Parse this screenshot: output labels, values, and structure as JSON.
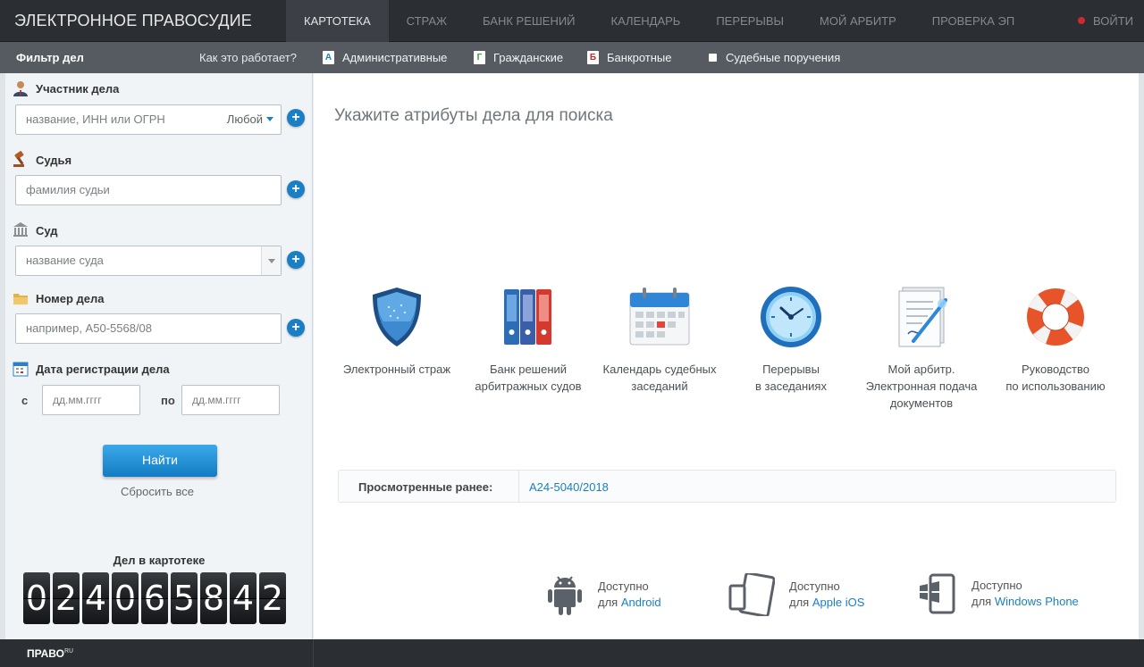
{
  "brand": "ЭЛЕКТРОННОЕ ПРАВОСУДИЕ",
  "nav": [
    "КАРТОТЕКА",
    "СТРАЖ",
    "БАНК РЕШЕНИЙ",
    "КАЛЕНДАРЬ",
    "ПЕРЕРЫВЫ",
    "МОЙ АРБИТР",
    "ПРОВЕРКА ЭП"
  ],
  "login": "ВОЙТИ",
  "subbar": {
    "filter_title": "Фильтр дел",
    "how": "Как это работает?",
    "categories": [
      {
        "badge": "А",
        "label": "Административные",
        "color": "#1a7fc4"
      },
      {
        "badge": "Г",
        "label": "Гражданские",
        "color": "#3a9b3a"
      },
      {
        "badge": "Б",
        "label": "Банкротные",
        "color": "#c0302c"
      },
      {
        "badge": "",
        "label": "Судебные поручения",
        "color": "#ffffff"
      }
    ]
  },
  "filter": {
    "participant": {
      "label": "Участник дела",
      "placeholder": "название, ИНН или ОГРН",
      "role": "Любой"
    },
    "judge": {
      "label": "Судья",
      "placeholder": "фамилия судьи"
    },
    "court": {
      "label": "Суд",
      "placeholder": "название суда"
    },
    "case_number": {
      "label": "Номер дела",
      "placeholder": "например, А50-5568/08"
    },
    "date": {
      "label": "Дата регистрации дела",
      "from_label": "с",
      "to_label": "по",
      "from_placeholder": "дд.мм.гггг",
      "to_placeholder": "дд.мм.гггг"
    },
    "find_label": "Найти",
    "reset_label": "Сбросить все",
    "counter_label": "Дел в картотеке",
    "counter_digits": [
      "0",
      "2",
      "4",
      "0",
      "6",
      "5",
      "8",
      "4",
      "2"
    ]
  },
  "main": {
    "heading": "Укажите атрибуты дела для поиска",
    "services": [
      {
        "line1": "Электронный страж",
        "line2": "",
        "line3": "",
        "icon": "shield-icon"
      },
      {
        "line1": "Банк решений",
        "line2": "арбитражных судов",
        "line3": "",
        "icon": "binders-icon"
      },
      {
        "line1": "Календарь судебных",
        "line2": "заседаний",
        "line3": "",
        "icon": "calendar-icon"
      },
      {
        "line1": "Перерывы",
        "line2": "в заседаниях",
        "line3": "",
        "icon": "clock-icon"
      },
      {
        "line1": "Мой арбитр.",
        "line2": "Электронная подача",
        "line3": "документов",
        "icon": "document-icon"
      },
      {
        "line1": "Руководство",
        "line2": "по использованию",
        "line3": "",
        "icon": "lifebuoy-icon"
      }
    ],
    "recent_label": "Просмотренные ранее:",
    "recent_value": "А24-5040/2018",
    "mobile": [
      {
        "avail": "Доступно",
        "pre": "для",
        "platform": "Android"
      },
      {
        "avail": "Доступно",
        "pre": "для",
        "platform": "Apple iOS"
      },
      {
        "avail": "Доступно",
        "pre": "для",
        "platform": "Windows Phone"
      }
    ]
  },
  "footer": {
    "logo": "ПРАВО",
    "logo_sup": "RU"
  }
}
